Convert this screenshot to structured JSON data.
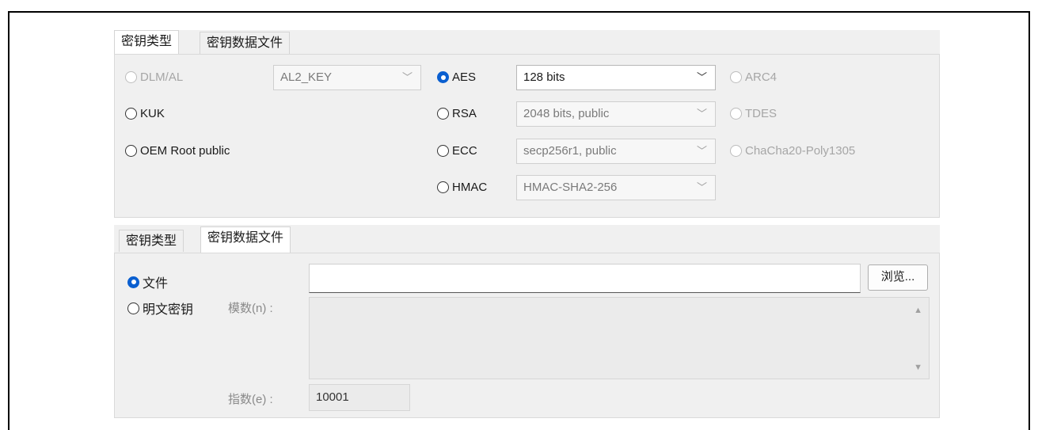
{
  "tabs_top": {
    "items": [
      "密钥类型",
      "密钥数据文件"
    ],
    "active": 0
  },
  "key_type": {
    "dlm": {
      "label": "DLM/AL",
      "select_value": "AL2_KEY"
    },
    "kuk": {
      "label": "KUK"
    },
    "oem": {
      "label": "OEM Root public"
    },
    "aes": {
      "label": "AES",
      "select_value": "128 bits"
    },
    "rsa": {
      "label": "RSA",
      "select_value": "2048 bits, public"
    },
    "ecc": {
      "label": "ECC",
      "select_value": "secp256r1, public"
    },
    "hmac": {
      "label": "HMAC",
      "select_value": "HMAC-SHA2-256"
    },
    "arc4": {
      "label": "ARC4"
    },
    "tdes": {
      "label": "TDES"
    },
    "chacha": {
      "label": "ChaCha20-Poly1305"
    }
  },
  "tabs_bottom": {
    "items": [
      "密钥类型",
      "密钥数据文件"
    ],
    "active": 1
  },
  "key_data": {
    "file_label": "文件",
    "file_path": "",
    "browse_label": "浏览...",
    "plaintext_label": "明文密钥",
    "modulus_label": "模数(n) :",
    "modulus_value": "",
    "exponent_label": "指数(e) :",
    "exponent_value": "10001"
  },
  "colors": {
    "accent": "#0a5fd0",
    "panel_bg": "#f0f0f0"
  }
}
